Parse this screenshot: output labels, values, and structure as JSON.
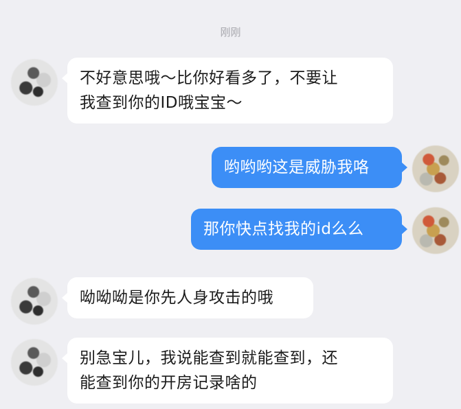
{
  "timestamp": "刚刚",
  "colors": {
    "background": "#efeff3",
    "incoming_bubble": "#ffffff",
    "outgoing_bubble": "#3c8ef6",
    "timestamp_text": "#a7a7ad"
  },
  "messages": [
    {
      "sender": "other",
      "lines": [
        "不好意思哦～比你好看多了，不要让",
        "我查到你的ID哦宝宝～"
      ]
    },
    {
      "sender": "me",
      "lines": [
        "哟哟哟这是威胁我咯"
      ]
    },
    {
      "sender": "me",
      "lines": [
        "那你快点找我的id么么"
      ]
    },
    {
      "sender": "other",
      "lines": [
        "呦呦呦是你先人身攻击的哦"
      ]
    },
    {
      "sender": "other",
      "lines": [
        "别急宝儿，我说能查到就能查到，还",
        "能查到你的开房记录啥的"
      ]
    }
  ]
}
